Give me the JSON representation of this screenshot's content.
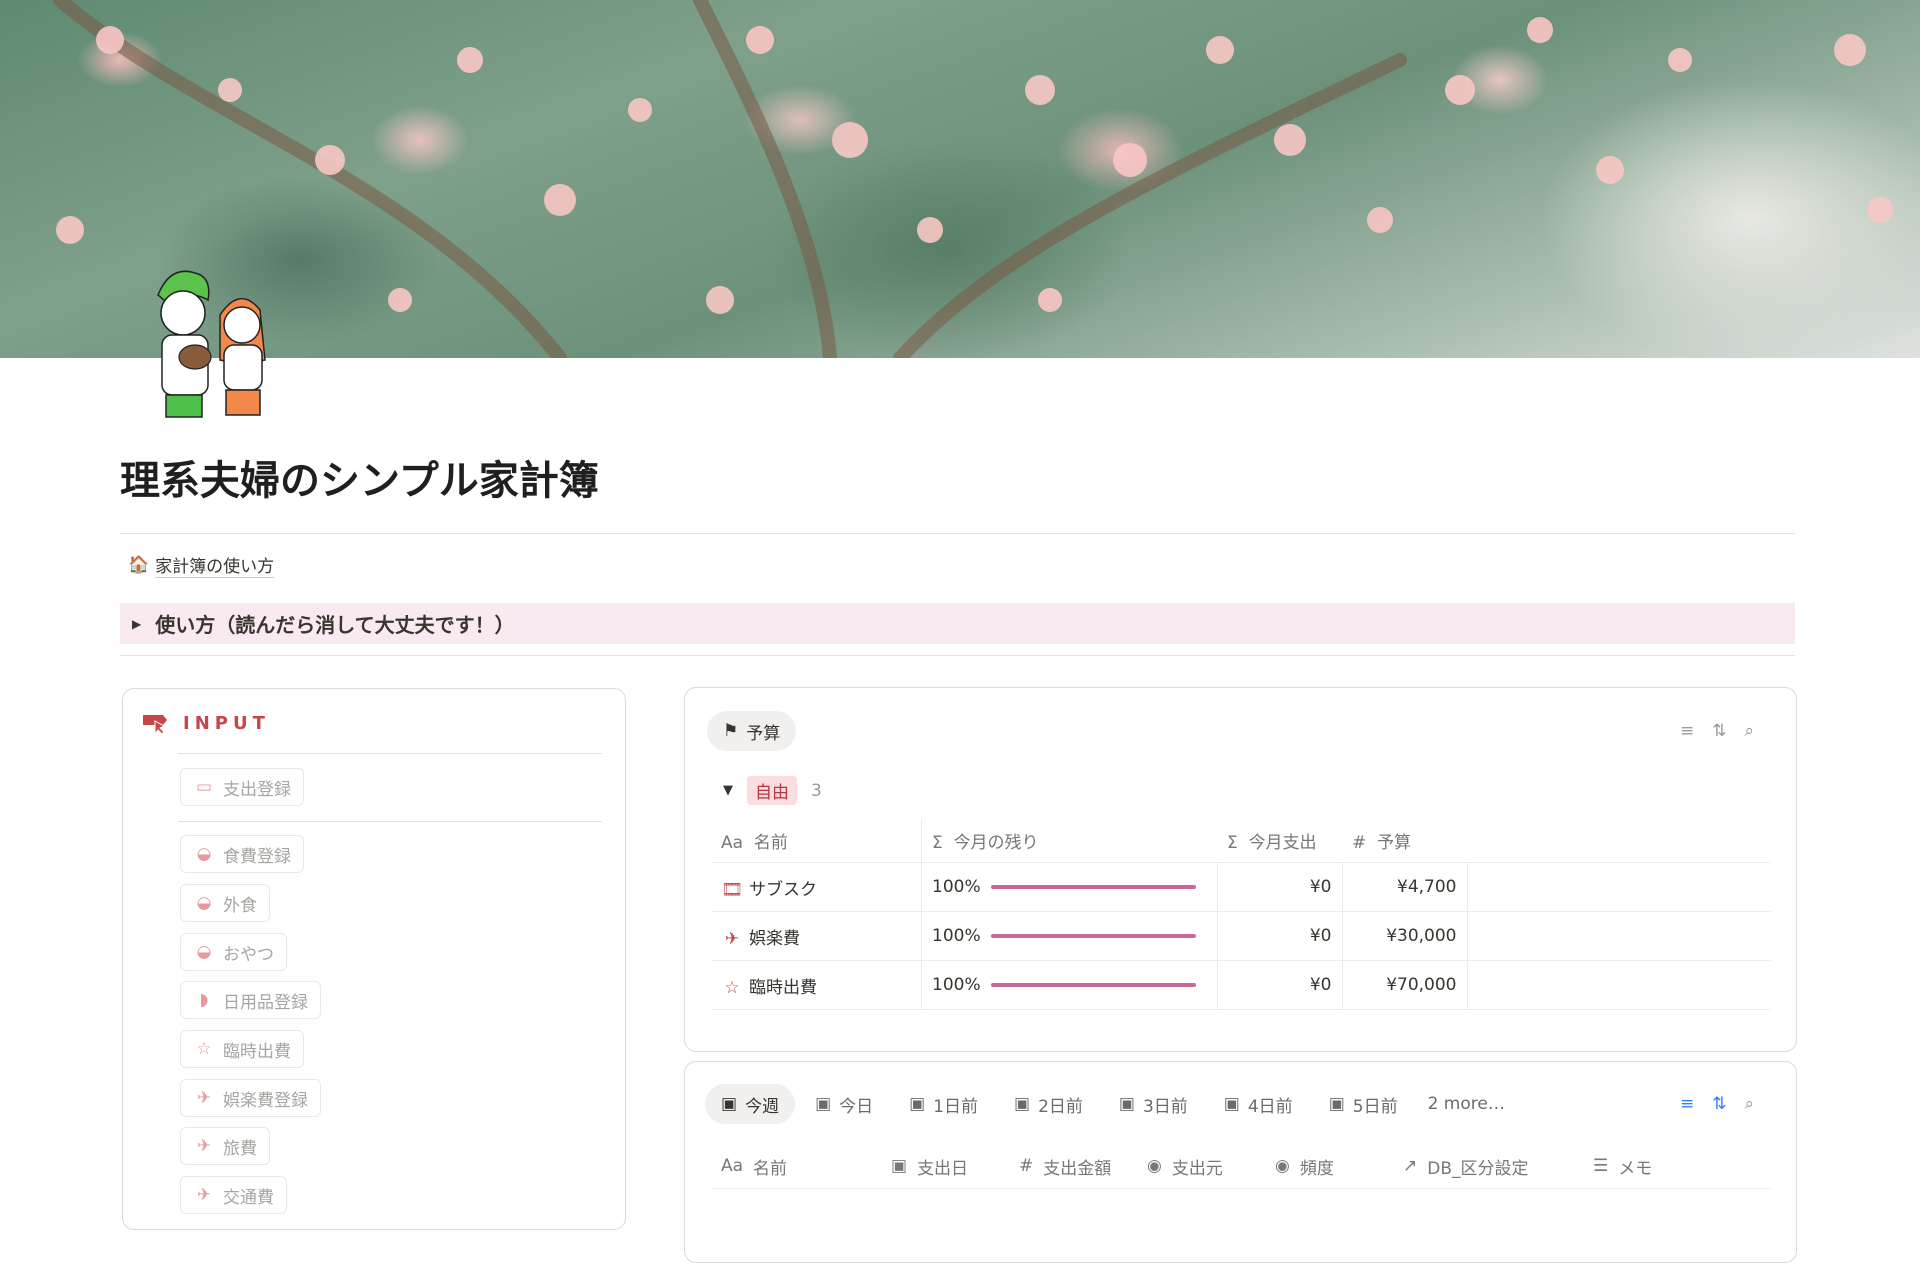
{
  "page": {
    "title": "理系夫婦のシンプル家計簿"
  },
  "link": {
    "icon": "house-icon",
    "label": "家計簿の使い方"
  },
  "toggle": {
    "label": "使い方（読んだら消して大丈夫です！）"
  },
  "input_panel": {
    "heading": "INPUT",
    "buttons": [
      {
        "label": "支出登録",
        "icon": "wallet-icon"
      },
      {
        "label": "食費登録",
        "icon": "bowl-icon"
      },
      {
        "label": "外食",
        "icon": "bowl-icon"
      },
      {
        "label": "おやつ",
        "icon": "bowl-icon"
      },
      {
        "label": "日用品登録",
        "icon": "soap-icon"
      },
      {
        "label": "臨時出費",
        "icon": "star-icon"
      },
      {
        "label": "娯楽費登録",
        "icon": "plane-icon"
      },
      {
        "label": "旅費",
        "icon": "plane-icon"
      },
      {
        "label": "交通費",
        "icon": "plane-icon"
      }
    ]
  },
  "budget_panel": {
    "view_tab": "予算",
    "group": {
      "label": "自由",
      "count": "3"
    },
    "columns": {
      "name": "名前",
      "remaining": "今月の残り",
      "spent": "今月支出",
      "budget": "予算"
    },
    "rows": [
      {
        "icon": "film-icon",
        "name": "サブスク",
        "remaining": "100%",
        "remaining_fraction": 1.0,
        "spent": "¥0",
        "budget": "¥4,700"
      },
      {
        "icon": "plane-icon",
        "name": "娯楽費",
        "remaining": "100%",
        "remaining_fraction": 1.0,
        "spent": "¥0",
        "budget": "¥30,000"
      },
      {
        "icon": "star-icon",
        "name": "臨時出費",
        "remaining": "100%",
        "remaining_fraction": 1.0,
        "spent": "¥0",
        "budget": "¥70,000"
      }
    ]
  },
  "tx_panel": {
    "tabs": [
      "今週",
      "今日",
      "1日前",
      "2日前",
      "3日前",
      "4日前",
      "5日前"
    ],
    "more": "2 more…",
    "columns": [
      "名前",
      "支出日",
      "支出金額",
      "支出元",
      "頻度",
      "DB_区分設定",
      "メモ"
    ]
  },
  "colors": {
    "accent": "#c4474a",
    "toggle_bg": "#f9e9f0",
    "bar": "#c9689a",
    "tool_active": "#2f80ed"
  }
}
